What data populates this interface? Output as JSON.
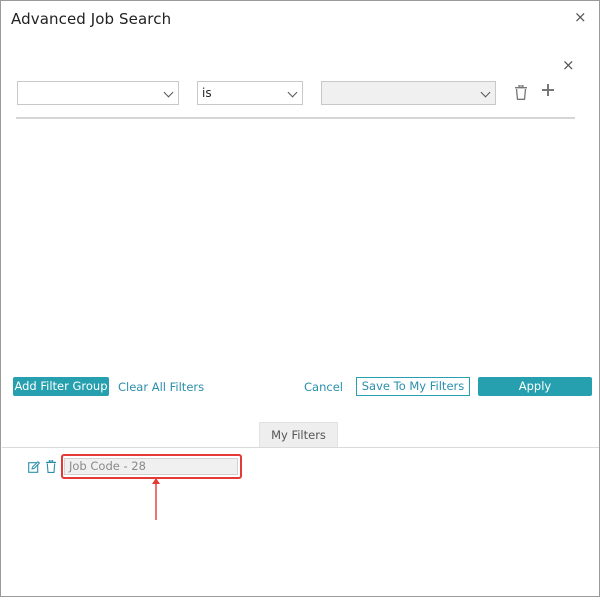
{
  "dialog": {
    "title": "Advanced Job Search",
    "close_glyph": "×"
  },
  "filter_group": {
    "close_glyph": "×",
    "field_select": {
      "value": ""
    },
    "operator_select": {
      "value": "is"
    },
    "value_select": {
      "value": ""
    }
  },
  "actions": {
    "add_filter_group": "Add Filter Group",
    "clear_all_filters": "Clear All Filters",
    "cancel": "Cancel",
    "save_to_my_filters": "Save To My Filters",
    "apply": "Apply"
  },
  "tabs": {
    "my_filters": "My Filters"
  },
  "saved_filters": [
    {
      "name": "Job Code - 28"
    }
  ],
  "colors": {
    "accent": "#26a0ae",
    "link": "#2a8fab",
    "annotation": "#e53935"
  },
  "icons": {
    "trash": "trash-icon",
    "plus": "plus-icon",
    "edit": "edit-icon",
    "close": "close-icon",
    "chevron": "chevron-down-icon"
  }
}
